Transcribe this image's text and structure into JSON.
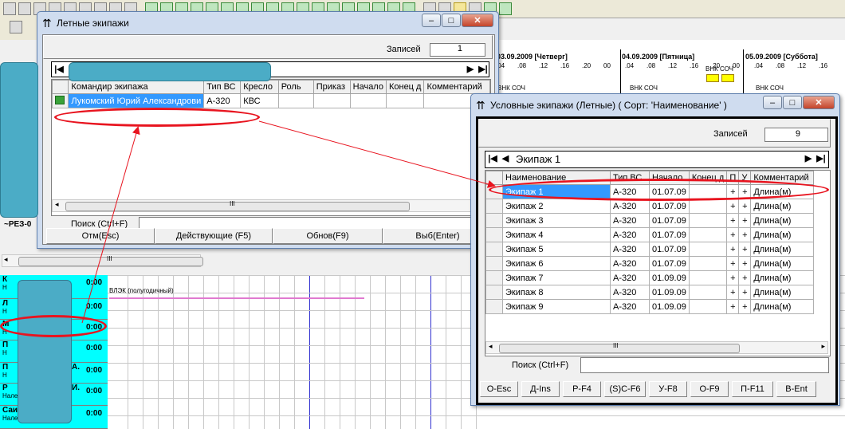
{
  "background": {
    "timeline": {
      "days": [
        "03.09.2009 [Четверг]",
        "04.09.2009 [Пятница]",
        "05.09.2009 [Суббота]"
      ],
      "hours": [
        ".04",
        ".08",
        ".12",
        ".16",
        ".20",
        "00",
        ".04",
        ".08",
        ".12",
        ".16",
        ".20",
        "00",
        ".04",
        ".08",
        ".12",
        ".16"
      ],
      "tags": [
        "ВНК СОЧ",
        "ВНК СОЧ",
        "ВНК СОЧ",
        "ВНК СОЧ"
      ],
      "event_label": "ВЛЭК (полугодичный)",
      "rez_label": "~РЕЗ-0"
    },
    "crew_rows": [
      {
        "name": "К",
        "sub": "Н",
        "time": "0:00"
      },
      {
        "name": "Л",
        "sub": "Н",
        "time": "0:00"
      },
      {
        "name": "М",
        "sub": "Н",
        "time": "0:00"
      },
      {
        "name": "П",
        "sub": "Н",
        "time": "0:00"
      },
      {
        "name": "П",
        "name_suffix": "А.",
        "sub": "Н",
        "time": "0:00"
      },
      {
        "name": "Р",
        "name_suffix": "И.",
        "sub": "Налет",
        "time": "0:00"
      },
      {
        "name": "Саитов Р.С.",
        "sub": "Налет",
        "time": "0:00"
      }
    ]
  },
  "win1": {
    "title": "Летные экипажи",
    "records_label": "Записей",
    "records_count": "1",
    "columns": [
      "Командир экипажа",
      "Тип ВС",
      "Кресло",
      "Роль",
      "Приказ",
      "Начало",
      "Конец д",
      "Комментарий"
    ],
    "rows": [
      [
        "Лукомский Юрий Александрови",
        "A-320",
        "КВС",
        "",
        "",
        "",
        "",
        ""
      ]
    ],
    "search_label": "Поиск (Ctrl+F)",
    "search_value": "",
    "buttons": [
      "Отм(Esc)",
      "Действующие (F5)",
      "Обнов(F9)",
      "Выб(Enter)"
    ]
  },
  "win2": {
    "title": "Условные экипажи (Летные) ( Сорт: 'Наименование' )",
    "records_label": "Записей",
    "records_count": "9",
    "current": "Экипаж 1",
    "columns": [
      "Наименование",
      "Тип ВС",
      "Начало",
      "Конец д",
      "П",
      "У",
      "Комментарий"
    ],
    "rows": [
      [
        "Экипаж 1",
        "A-320",
        "01.07.09",
        "",
        "+",
        "+",
        "Длина(м)"
      ],
      [
        "Экипаж 2",
        "A-320",
        "01.07.09",
        "",
        "+",
        "+",
        "Длина(м)"
      ],
      [
        "Экипаж 3",
        "A-320",
        "01.07.09",
        "",
        "+",
        "+",
        "Длина(м)"
      ],
      [
        "Экипаж 4",
        "A-320",
        "01.07.09",
        "",
        "+",
        "+",
        "Длина(м)"
      ],
      [
        "Экипаж 5",
        "A-320",
        "01.07.09",
        "",
        "+",
        "+",
        "Длина(м)"
      ],
      [
        "Экипаж 6",
        "A-320",
        "01.07.09",
        "",
        "+",
        "+",
        "Длина(м)"
      ],
      [
        "Экипаж 7",
        "A-320",
        "01.09.09",
        "",
        "+",
        "+",
        "Длина(м)"
      ],
      [
        "Экипаж 8",
        "A-320",
        "01.09.09",
        "",
        "+",
        "+",
        "Длина(м)"
      ],
      [
        "Экипаж 9",
        "A-320",
        "01.09.09",
        "",
        "+",
        "+",
        "Длина(м)"
      ]
    ],
    "search_label": "Поиск (Ctrl+F)",
    "search_value": "",
    "buttons": [
      "O-Esc",
      "Д-Ins",
      "P-F4",
      "(S)C-F6",
      "У-F8",
      "O-F9",
      "П-F11",
      "B-Ent"
    ]
  },
  "scrollbar_glyph": "III",
  "colors": {
    "accent": "#3399ff",
    "annotation": "#e8141f",
    "overlay": "#4bacc6",
    "crew_cell": "#00ffff"
  }
}
